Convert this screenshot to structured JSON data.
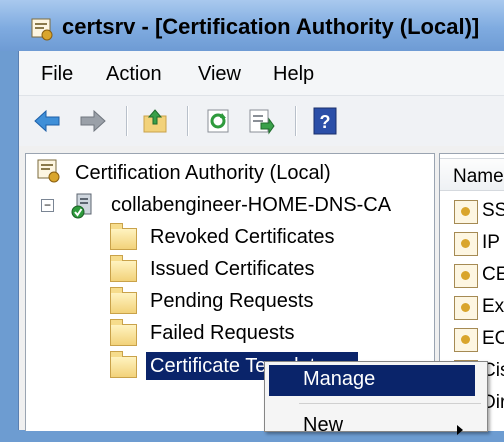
{
  "window": {
    "title": "certsrv - [Certification Authority (Local)]"
  },
  "menubar": [
    "File",
    "Action",
    "View",
    "Help"
  ],
  "toolbar": {
    "buttons": [
      "back-icon",
      "forward-icon",
      "up-folder-icon",
      "refresh-icon",
      "export-list-icon",
      "help-icon"
    ]
  },
  "tree": {
    "root": "Certification Authority (Local)",
    "ca": "collabengineer-HOME-DNS-CA",
    "ca_expander": "−",
    "children": [
      "Revoked Certificates",
      "Issued Certificates",
      "Pending Requests",
      "Failed Requests",
      "Certificate Templates"
    ]
  },
  "right_pane": {
    "column_header": "Name",
    "items": [
      "SS",
      "IP",
      "CE",
      "Ex",
      "EC",
      "Cis",
      "Dir"
    ]
  },
  "context_menu": {
    "items": [
      "Manage",
      "New"
    ]
  },
  "colors": {
    "selection": "#0a246a",
    "title_bar": "#7fabe0"
  }
}
